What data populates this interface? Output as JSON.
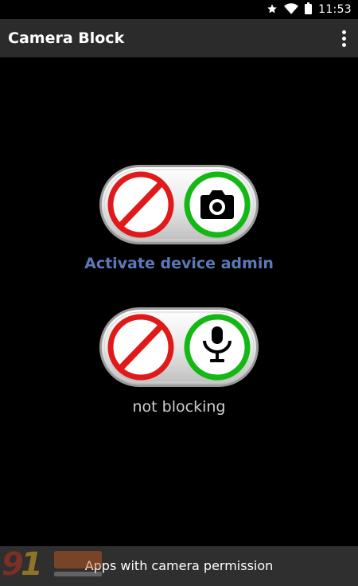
{
  "status_bar": {
    "time": "11:53",
    "icons": [
      "star-icon",
      "wifi-icon",
      "battery-icon"
    ]
  },
  "app_bar": {
    "title": "Camera Block",
    "menu_icon": "overflow-menu-icon"
  },
  "camera_toggle": {
    "left_icon": "block-icon",
    "right_icon": "camera-icon",
    "caption": "Activate device admin"
  },
  "mic_toggle": {
    "left_icon": "block-icon",
    "right_icon": "microphone-icon",
    "status": "not blocking"
  },
  "bottom_bar": {
    "button_label": "Apps with camera permission"
  },
  "colors": {
    "background": "#000000",
    "app_bar": "#2b2b2b",
    "block_red": "#e01a1a",
    "active_green": "#14b814",
    "admin_link": "#5a79b8",
    "status_text": "#cfcfcf"
  }
}
